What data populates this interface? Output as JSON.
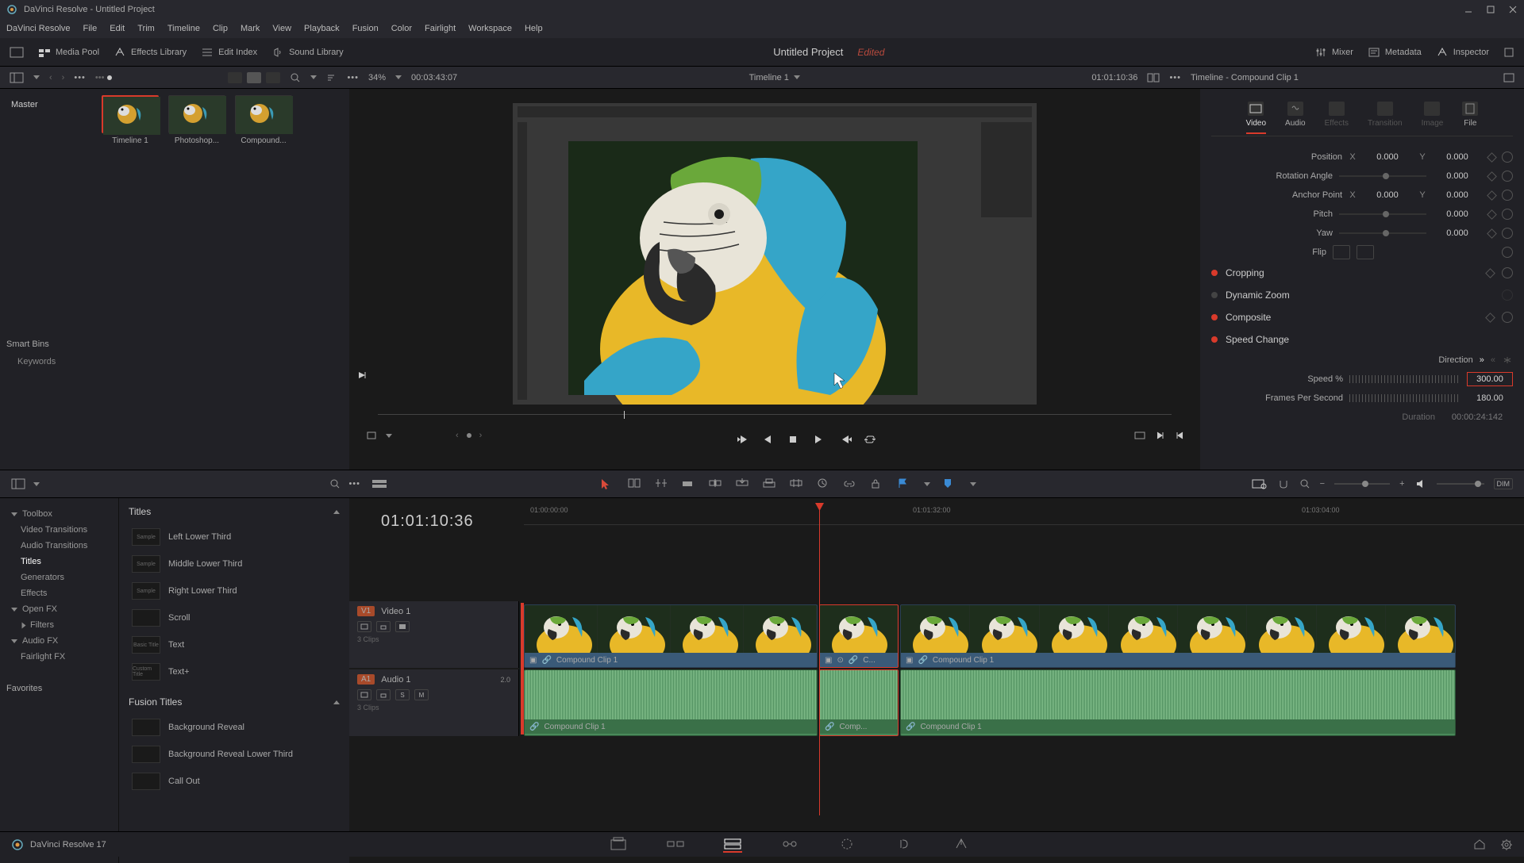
{
  "window": {
    "title": "DaVinci Resolve - Untitled Project"
  },
  "menubar": [
    "DaVinci Resolve",
    "File",
    "Edit",
    "Trim",
    "Timeline",
    "Clip",
    "Mark",
    "View",
    "Playback",
    "Fusion",
    "Color",
    "Fairlight",
    "Workspace",
    "Help"
  ],
  "toolbar": {
    "media_pool": "Media Pool",
    "effects_library": "Effects Library",
    "edit_index": "Edit Index",
    "sound_library": "Sound Library",
    "project": "Untitled Project",
    "edited": "Edited",
    "mixer": "Mixer",
    "metadata": "Metadata",
    "inspector": "Inspector"
  },
  "viewbar": {
    "zoom": "34%",
    "source_tc": "00:03:43:07",
    "timeline_name": "Timeline 1",
    "record_tc": "01:01:10:36",
    "inspector_title": "Timeline - Compound Clip 1"
  },
  "media": {
    "master": "Master",
    "items": [
      {
        "label": "Timeline 1"
      },
      {
        "label": "Photoshop..."
      },
      {
        "label": "Compound..."
      }
    ],
    "smart_bins": "Smart Bins",
    "keywords": "Keywords"
  },
  "inspector": {
    "tabs": [
      "Video",
      "Audio",
      "Effects",
      "Transition",
      "Image",
      "File"
    ],
    "position": "Position",
    "pos_x": "0.000",
    "pos_y": "0.000",
    "rotation": "Rotation Angle",
    "rot_val": "0.000",
    "anchor": "Anchor Point",
    "anc_x": "0.000",
    "anc_y": "0.000",
    "pitch": "Pitch",
    "pitch_val": "0.000",
    "yaw": "Yaw",
    "yaw_val": "0.000",
    "flip": "Flip",
    "cropping": "Cropping",
    "dynamic_zoom": "Dynamic Zoom",
    "composite": "Composite",
    "speed_change": "Speed Change",
    "direction": "Direction",
    "speed_pct": "Speed %",
    "speed_val": "300.00",
    "fps": "Frames Per Second",
    "fps_val": "180.00",
    "duration": "Duration",
    "duration_val": "00:00:24:142"
  },
  "effects": {
    "toolbox": "Toolbox",
    "video_transitions": "Video Transitions",
    "audio_transitions": "Audio Transitions",
    "titles_tree": "Titles",
    "generators": "Generators",
    "effects_tree": "Effects",
    "open_fx": "Open FX",
    "filters": "Filters",
    "audio_fx": "Audio FX",
    "fairlight_fx": "Fairlight FX",
    "favorites": "Favorites",
    "titles_header": "Titles",
    "titles_items": [
      "Left Lower Third",
      "Middle Lower Third",
      "Right Lower Third",
      "Scroll",
      "Text",
      "Text+"
    ],
    "fusion_header": "Fusion Titles",
    "fusion_items": [
      "Background Reveal",
      "Background Reveal Lower Third",
      "Call Out"
    ],
    "basic": "Basic Title",
    "custom": "Custom Title",
    "sample": "Sample"
  },
  "timeline": {
    "tc": "01:01:10:36",
    "ticks": {
      "t0": "01:00:00:00",
      "t1": "01:01:32:00",
      "t2": "01:03:04:00"
    },
    "v1": "V1",
    "video1": "Video 1",
    "video_meta": "3 Clips",
    "a1": "A1",
    "audio1": "Audio 1",
    "audio_ch": "2.0",
    "audio_meta": "3 Clips",
    "solo": "S",
    "mute": "M",
    "clips": {
      "v": [
        {
          "name": "Compound Clip 1"
        },
        {
          "name": "C..."
        },
        {
          "name": "Compound Clip 1"
        }
      ],
      "a": [
        {
          "name": "Compound Clip 1"
        },
        {
          "name": "Comp..."
        },
        {
          "name": "Compound Clip 1"
        }
      ]
    }
  },
  "footer": {
    "app": "DaVinci Resolve 17"
  }
}
